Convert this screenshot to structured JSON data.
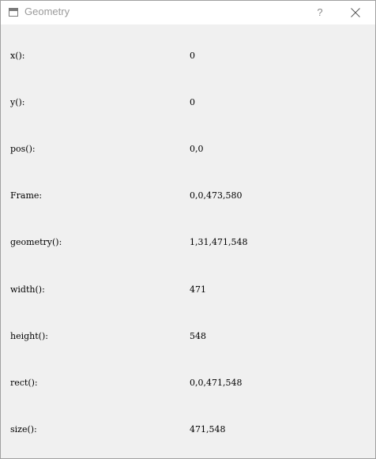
{
  "window": {
    "title": "Geometry",
    "help_label": "?"
  },
  "rows": [
    {
      "label": "x():",
      "value": "0"
    },
    {
      "label": "y():",
      "value": "0"
    },
    {
      "label": "pos():",
      "value": "0,0"
    },
    {
      "label": "Frame:",
      "value": "0,0,473,580"
    },
    {
      "label": "geometry():",
      "value": "1,31,471,548"
    },
    {
      "label": "width():",
      "value": "471"
    },
    {
      "label": "height():",
      "value": "548"
    },
    {
      "label": "rect():",
      "value": "0,0,471,548"
    },
    {
      "label": "size():",
      "value": "471,548"
    }
  ]
}
